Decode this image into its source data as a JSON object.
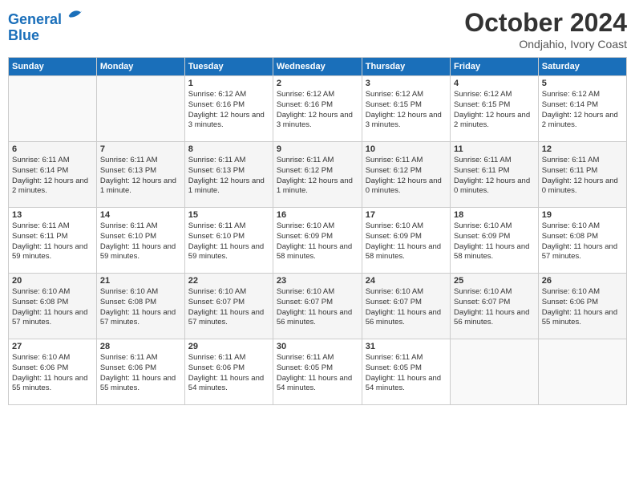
{
  "header": {
    "logo_line1": "General",
    "logo_line2": "Blue",
    "month_title": "October 2024",
    "subtitle": "Ondjahio, Ivory Coast"
  },
  "days_of_week": [
    "Sunday",
    "Monday",
    "Tuesday",
    "Wednesday",
    "Thursday",
    "Friday",
    "Saturday"
  ],
  "weeks": [
    [
      {
        "day": "",
        "lines": []
      },
      {
        "day": "",
        "lines": []
      },
      {
        "day": "1",
        "lines": [
          "Sunrise: 6:12 AM",
          "Sunset: 6:16 PM",
          "Daylight: 12 hours and 3 minutes."
        ]
      },
      {
        "day": "2",
        "lines": [
          "Sunrise: 6:12 AM",
          "Sunset: 6:16 PM",
          "Daylight: 12 hours and 3 minutes."
        ]
      },
      {
        "day": "3",
        "lines": [
          "Sunrise: 6:12 AM",
          "Sunset: 6:15 PM",
          "Daylight: 12 hours and 3 minutes."
        ]
      },
      {
        "day": "4",
        "lines": [
          "Sunrise: 6:12 AM",
          "Sunset: 6:15 PM",
          "Daylight: 12 hours and 2 minutes."
        ]
      },
      {
        "day": "5",
        "lines": [
          "Sunrise: 6:12 AM",
          "Sunset: 6:14 PM",
          "Daylight: 12 hours and 2 minutes."
        ]
      }
    ],
    [
      {
        "day": "6",
        "lines": [
          "Sunrise: 6:11 AM",
          "Sunset: 6:14 PM",
          "Daylight: 12 hours and 2 minutes."
        ]
      },
      {
        "day": "7",
        "lines": [
          "Sunrise: 6:11 AM",
          "Sunset: 6:13 PM",
          "Daylight: 12 hours and 1 minute."
        ]
      },
      {
        "day": "8",
        "lines": [
          "Sunrise: 6:11 AM",
          "Sunset: 6:13 PM",
          "Daylight: 12 hours and 1 minute."
        ]
      },
      {
        "day": "9",
        "lines": [
          "Sunrise: 6:11 AM",
          "Sunset: 6:12 PM",
          "Daylight: 12 hours and 1 minute."
        ]
      },
      {
        "day": "10",
        "lines": [
          "Sunrise: 6:11 AM",
          "Sunset: 6:12 PM",
          "Daylight: 12 hours and 0 minutes."
        ]
      },
      {
        "day": "11",
        "lines": [
          "Sunrise: 6:11 AM",
          "Sunset: 6:11 PM",
          "Daylight: 12 hours and 0 minutes."
        ]
      },
      {
        "day": "12",
        "lines": [
          "Sunrise: 6:11 AM",
          "Sunset: 6:11 PM",
          "Daylight: 12 hours and 0 minutes."
        ]
      }
    ],
    [
      {
        "day": "13",
        "lines": [
          "Sunrise: 6:11 AM",
          "Sunset: 6:11 PM",
          "Daylight: 11 hours and 59 minutes."
        ]
      },
      {
        "day": "14",
        "lines": [
          "Sunrise: 6:11 AM",
          "Sunset: 6:10 PM",
          "Daylight: 11 hours and 59 minutes."
        ]
      },
      {
        "day": "15",
        "lines": [
          "Sunrise: 6:11 AM",
          "Sunset: 6:10 PM",
          "Daylight: 11 hours and 59 minutes."
        ]
      },
      {
        "day": "16",
        "lines": [
          "Sunrise: 6:10 AM",
          "Sunset: 6:09 PM",
          "Daylight: 11 hours and 58 minutes."
        ]
      },
      {
        "day": "17",
        "lines": [
          "Sunrise: 6:10 AM",
          "Sunset: 6:09 PM",
          "Daylight: 11 hours and 58 minutes."
        ]
      },
      {
        "day": "18",
        "lines": [
          "Sunrise: 6:10 AM",
          "Sunset: 6:09 PM",
          "Daylight: 11 hours and 58 minutes."
        ]
      },
      {
        "day": "19",
        "lines": [
          "Sunrise: 6:10 AM",
          "Sunset: 6:08 PM",
          "Daylight: 11 hours and 57 minutes."
        ]
      }
    ],
    [
      {
        "day": "20",
        "lines": [
          "Sunrise: 6:10 AM",
          "Sunset: 6:08 PM",
          "Daylight: 11 hours and 57 minutes."
        ]
      },
      {
        "day": "21",
        "lines": [
          "Sunrise: 6:10 AM",
          "Sunset: 6:08 PM",
          "Daylight: 11 hours and 57 minutes."
        ]
      },
      {
        "day": "22",
        "lines": [
          "Sunrise: 6:10 AM",
          "Sunset: 6:07 PM",
          "Daylight: 11 hours and 57 minutes."
        ]
      },
      {
        "day": "23",
        "lines": [
          "Sunrise: 6:10 AM",
          "Sunset: 6:07 PM",
          "Daylight: 11 hours and 56 minutes."
        ]
      },
      {
        "day": "24",
        "lines": [
          "Sunrise: 6:10 AM",
          "Sunset: 6:07 PM",
          "Daylight: 11 hours and 56 minutes."
        ]
      },
      {
        "day": "25",
        "lines": [
          "Sunrise: 6:10 AM",
          "Sunset: 6:07 PM",
          "Daylight: 11 hours and 56 minutes."
        ]
      },
      {
        "day": "26",
        "lines": [
          "Sunrise: 6:10 AM",
          "Sunset: 6:06 PM",
          "Daylight: 11 hours and 55 minutes."
        ]
      }
    ],
    [
      {
        "day": "27",
        "lines": [
          "Sunrise: 6:10 AM",
          "Sunset: 6:06 PM",
          "Daylight: 11 hours and 55 minutes."
        ]
      },
      {
        "day": "28",
        "lines": [
          "Sunrise: 6:11 AM",
          "Sunset: 6:06 PM",
          "Daylight: 11 hours and 55 minutes."
        ]
      },
      {
        "day": "29",
        "lines": [
          "Sunrise: 6:11 AM",
          "Sunset: 6:06 PM",
          "Daylight: 11 hours and 54 minutes."
        ]
      },
      {
        "day": "30",
        "lines": [
          "Sunrise: 6:11 AM",
          "Sunset: 6:05 PM",
          "Daylight: 11 hours and 54 minutes."
        ]
      },
      {
        "day": "31",
        "lines": [
          "Sunrise: 6:11 AM",
          "Sunset: 6:05 PM",
          "Daylight: 11 hours and 54 minutes."
        ]
      },
      {
        "day": "",
        "lines": []
      },
      {
        "day": "",
        "lines": []
      }
    ]
  ]
}
